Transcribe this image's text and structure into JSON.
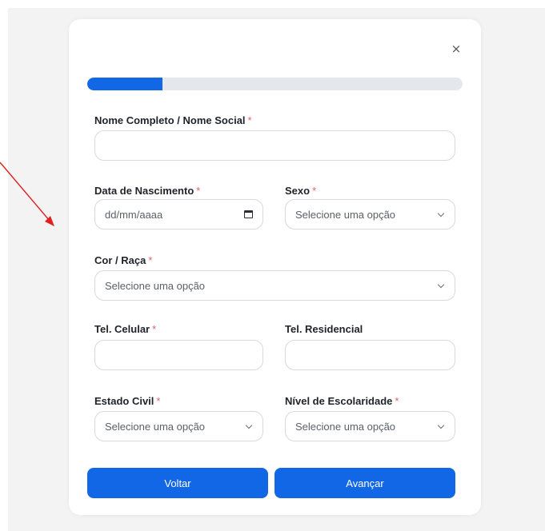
{
  "header": {
    "close_label": "×"
  },
  "progress": {
    "percent": 20
  },
  "fields": {
    "nome": {
      "label": "Nome Completo / Nome Social",
      "required": "*",
      "value": ""
    },
    "data_nascimento": {
      "label": "Data de Nascimento",
      "required": "*",
      "placeholder": "dd/mm/aaaa"
    },
    "sexo": {
      "label": "Sexo",
      "required": "*",
      "selected": "Selecione uma opção"
    },
    "cor_raca": {
      "label": "Cor / Raça",
      "required": "*",
      "selected": "Selecione uma opção"
    },
    "tel_celular": {
      "label": "Tel. Celular",
      "required": "*",
      "value": ""
    },
    "tel_residencial": {
      "label": "Tel. Residencial",
      "value": ""
    },
    "estado_civil": {
      "label": "Estado Civil",
      "required": "*",
      "selected": "Selecione uma opção"
    },
    "escolaridade": {
      "label": "Nível de Escolaridade",
      "required": "*",
      "selected": "Selecione uma opção"
    }
  },
  "buttons": {
    "back_label": "Voltar",
    "next_label": "Avançar"
  },
  "colors": {
    "accent": "#1267e6",
    "required": "#e0606b",
    "annotation": "#e02020"
  },
  "icons": [
    "close-icon",
    "calendar-icon",
    "chevron-down-icon",
    "annotation-arrow-icon"
  ]
}
